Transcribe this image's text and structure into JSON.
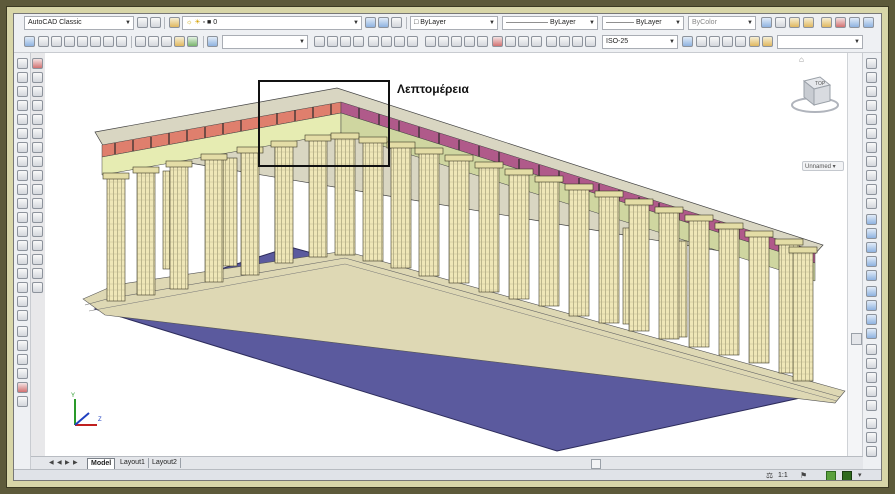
{
  "toolbar1": {
    "workspace": "AutoCAD Classic",
    "layer": "0",
    "color": "ByLayer",
    "linetype": "ByLayer",
    "lineweight": "ByLayer",
    "plotstyle": "ByColor"
  },
  "toolbar2": {
    "dimstyle": "ISO-25"
  },
  "viewport": {
    "annotation": "Λεπτομέρεια",
    "viewcube_face": "TOP",
    "view_name": "Unnamed"
  },
  "layout_tabs": [
    {
      "label": "Model",
      "active": true
    },
    {
      "label": "Layout1",
      "active": false
    },
    {
      "label": "Layout2",
      "active": false
    }
  ],
  "status": {
    "annotation_scale": "1:1"
  },
  "colors": {
    "ground": "#5b5a9e",
    "column": "#efe7b8",
    "architrave": "#e6ecb2",
    "metope_front": "#df7f6d",
    "metope_side": "#b05a8a",
    "frame": "#d8d6a8"
  }
}
